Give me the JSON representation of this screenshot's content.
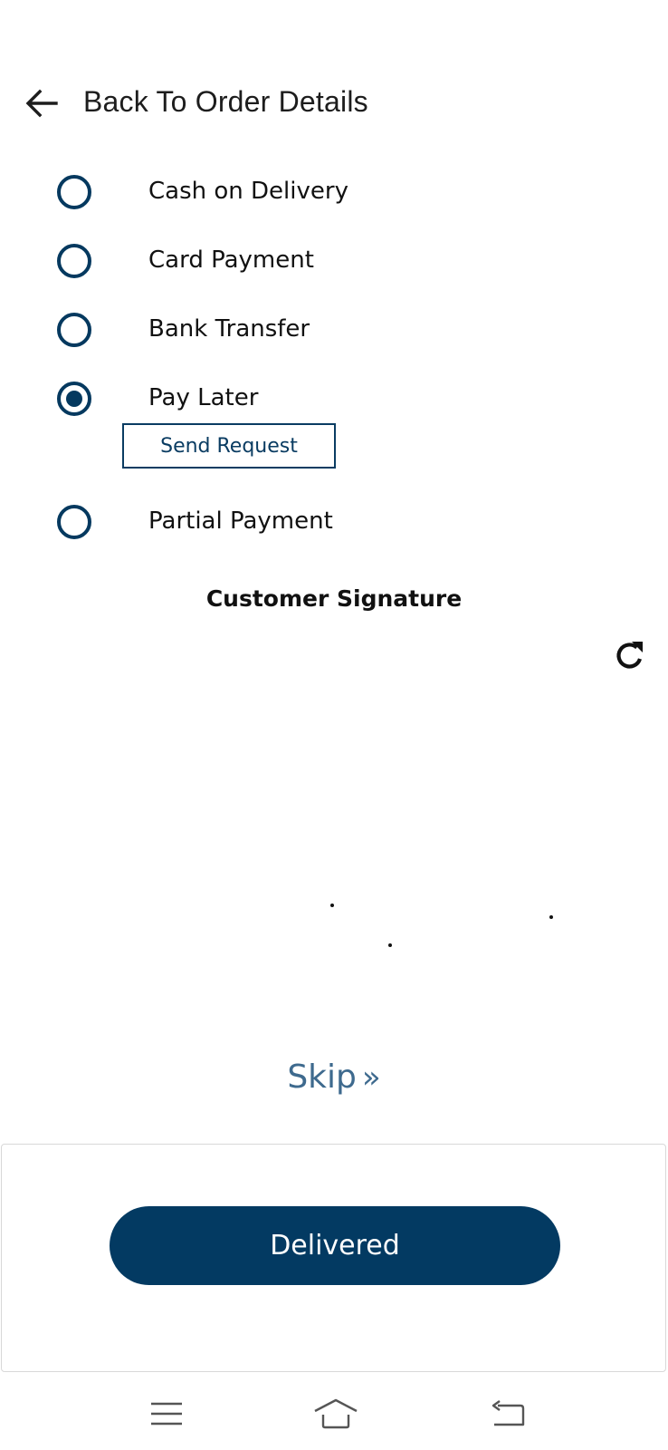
{
  "header": {
    "title": "Back To Order Details",
    "back_icon": "arrow-left-icon"
  },
  "payment_options": [
    {
      "label": "Cash on Delivery",
      "selected": false
    },
    {
      "label": "Card Payment",
      "selected": false
    },
    {
      "label": "Bank Transfer",
      "selected": false
    },
    {
      "label": "Pay Later",
      "selected": true
    },
    {
      "label": "Partial Payment",
      "selected": false
    }
  ],
  "send_request_label": "Send Request",
  "signature": {
    "title": "Customer Signature",
    "refresh_icon": "refresh-icon"
  },
  "skip": {
    "label": "Skip",
    "icon": "double-chevron-right-icon",
    "glyph": "»"
  },
  "delivered_label": "Delivered",
  "system_nav": {
    "menu_icon": "menu-icon",
    "home_icon": "home-icon",
    "back_icon": "back-icon"
  },
  "colors": {
    "primary": "#033a62",
    "radio": "#05395f",
    "skip": "#3e6a8e",
    "text": "#111111"
  }
}
